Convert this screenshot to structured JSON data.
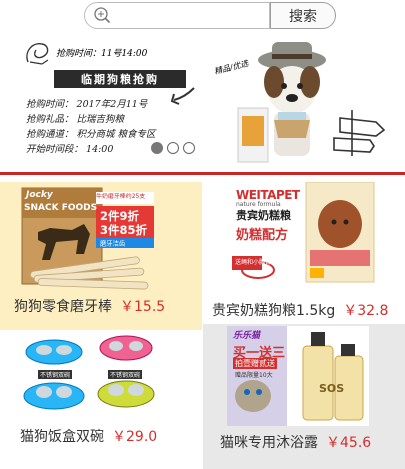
{
  "search": {
    "placeholder": "",
    "button_label": "搜索"
  },
  "banner": {
    "time_line": "抢购时间：11号14:00",
    "title": "临期狗粮抢购",
    "tag": "精品/优选",
    "details": [
      "抢购时间： 2017年2月11号",
      "抢购礼品： 比瑞吉狗粮",
      "抢购通道： 积分商城 粮食专区",
      "开始时间段： 14:00"
    ],
    "dots": [
      true,
      false,
      false
    ]
  },
  "products": [
    {
      "name": "狗狗零食磨牙棒",
      "price": "￥15.5",
      "image": {
        "brand": "Jocky",
        "brand_line": "SNACK FOODS",
        "promo_top": "牛奶磨牙棒约25支",
        "promo_1": "2件9折",
        "promo_2": "3件85折",
        "promo_3": "磨牙洁齿"
      }
    },
    {
      "name": "贵宾奶糕狗粮1.5kg",
      "price": "￥32.8",
      "image": {
        "brand": "WEITAPET",
        "brand_sub": "nature formula",
        "title": "贵宾奶糕粮",
        "subtitle": "奶糕配方",
        "gift": "送绳和小胸背"
      }
    },
    {
      "name": "猫狗饭盒双碗",
      "price": "￥29.0",
      "image": {
        "tag1": "不锈钢双碗",
        "tag2": "不锈钢双碗"
      }
    },
    {
      "name": "猫咪专用沐浴露",
      "price": "￥45.6",
      "image": {
        "brand": "乐乐猫",
        "banner_1": "买一送三",
        "banner_2": "拍壹赠贰送",
        "banner_3": "赠品限量10大",
        "label": "SOS"
      }
    }
  ]
}
